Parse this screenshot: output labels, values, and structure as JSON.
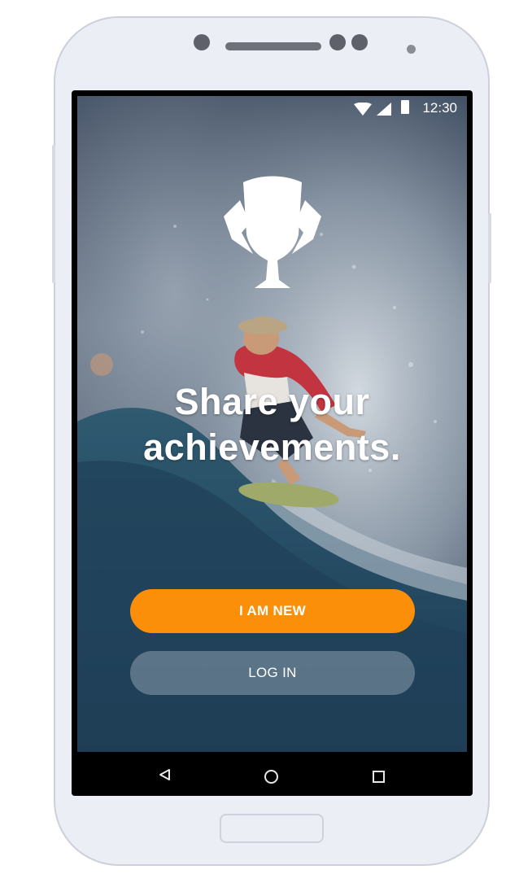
{
  "status_bar": {
    "time": "12:30",
    "icons": [
      "wifi-icon",
      "cellular-signal-icon",
      "battery-icon"
    ]
  },
  "hero": {
    "headline_line1": "Share your",
    "headline_line2": "achievements.",
    "logo": "trophy-icon"
  },
  "buttons": {
    "new_label": "I AM NEW",
    "login_label": "LOG IN"
  },
  "nav_bar": {
    "icons": [
      "back-icon",
      "home-icon",
      "recent-apps-icon"
    ]
  },
  "colors": {
    "accent": "#fb8f0a",
    "secondary_button": "#9aa7b4",
    "text": "#ffffff",
    "nav_bg": "#000000"
  }
}
